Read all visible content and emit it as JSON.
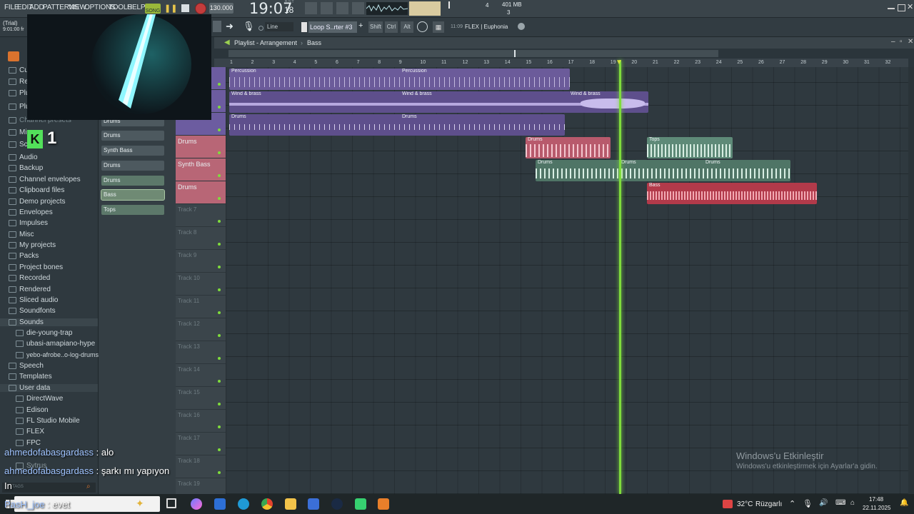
{
  "menu": [
    "FILE",
    "EDIT",
    "ADD",
    "PATTERNS",
    "VIEW",
    "OPTIONS",
    "TOOLS",
    "HELP"
  ],
  "song_mode": "SONG",
  "tempo": "130.000",
  "time": "19:07",
  "time_sub": "18",
  "time_mode": "B:S:T",
  "memory": "401 MB",
  "cpu_count": "4",
  "voices": "3",
  "trial": "(Trial)",
  "trial_time": "9:01:00 fr",
  "snap": "Line",
  "pattern": "Loop S..rter #3",
  "keys": [
    "Shift",
    "Ctrl",
    "Alt"
  ],
  "hint_time": "11:09",
  "hint_text": "FLEX | Euphonia",
  "playlist": {
    "title": "Playlist - Arrangement",
    "pattern": "Bass"
  },
  "ruler": [
    "1",
    "2",
    "3",
    "4",
    "5",
    "6",
    "7",
    "8",
    "9",
    "10",
    "11",
    "12",
    "13",
    "14",
    "15",
    "16",
    "17",
    "18",
    "19",
    "20",
    "21",
    "22",
    "23",
    "24",
    "25",
    "26",
    "27",
    "28",
    "29",
    "30",
    "31",
    "32"
  ],
  "browser": [
    "Channel presets",
    "Mi",
    "Sc",
    "Audio",
    "Backup",
    "Channel envelopes",
    "Clipboard files",
    "Demo projects",
    "Envelopes",
    "Impulses",
    "Misc",
    "My projects",
    "Packs",
    "Project bones",
    "Recorded",
    "Rendered",
    "Sliced audio",
    "Soundfonts",
    "Sounds",
    "die-young-trap",
    "ubasi-amapiano-hype",
    "yebo-afrobe..o-log-drums",
    "Speech",
    "Templates",
    "User data",
    "DirectWave",
    "Edison",
    "FL Studio Mobile",
    "FLEX",
    "FPC",
    "Sytrus"
  ],
  "browser_top": [
    "Cur",
    "Rec",
    "Plu",
    "Plu"
  ],
  "rack": [
    "Drums",
    "Drums",
    "Synth Bass",
    "Drums",
    "Drums",
    "Bass",
    "Tops"
  ],
  "tracks": [
    "",
    "",
    "",
    "Drums",
    "Synth Bass",
    "Drums",
    "Track 7",
    "Track 8",
    "Track 9",
    "Track 10",
    "Track 11",
    "Track 12",
    "Track 13",
    "Track 14",
    "Track 15",
    "Track 16",
    "Track 17",
    "Track 18",
    "Track 19"
  ],
  "clips": [
    {
      "label": "Percussion",
      "label2": "Percussion",
      "color": "#7866a8"
    },
    {
      "label": "Wind & brass",
      "label2": "Wind & brass",
      "label3": "Wind & brass",
      "color": "#6e5a9c"
    },
    {
      "label": "Drums",
      "label2": "Drums",
      "color": "#6a5a98"
    },
    {
      "label": "Drums",
      "color": "#c96a7a"
    },
    {
      "label": "Tops",
      "color": "#6fa08a"
    },
    {
      "label": "Drums",
      "label2": "Drums",
      "label3": "Drums",
      "color": "#5f8c7c"
    },
    {
      "label": "Bass",
      "color": "#c8505e"
    }
  ],
  "chat": [
    {
      "user": "ahmedofabasgardass",
      "msg": " : alo"
    },
    {
      "user": "ahmedofabasgardass",
      "msg": " : şarkı mı yapıyon"
    },
    {
      "user": "PasH_joe",
      "msg": " : evet"
    }
  ],
  "chat_prefix": "In",
  "overlay_badge": "1",
  "watermark": {
    "title": "Windows'u Etkinleştir",
    "sub": "Windows'u etkinleştirmek için Ayarlar'a gidin."
  },
  "taskbar": {
    "weather": "32°C",
    "weather_label": "Rüzgarlı",
    "clock": "17:48",
    "date": "22.11.2025"
  },
  "browser_search_placeholder": "TAGS"
}
